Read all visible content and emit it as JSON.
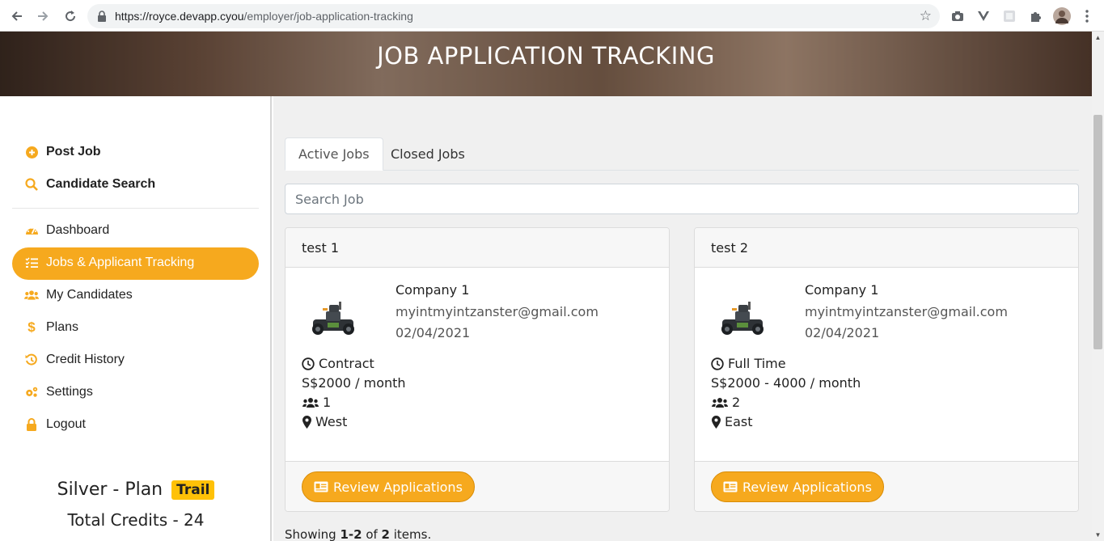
{
  "browser": {
    "url_host": "https://royce.devapp.cyou",
    "url_path": "/employer/job-application-tracking",
    "back_icon": "arrow-left-icon",
    "forward_icon": "arrow-right-icon",
    "reload_icon": "reload-icon"
  },
  "banner": {
    "title": "JOB APPLICATION TRACKING"
  },
  "sidebar": {
    "top_links": [
      {
        "label": "Post Job",
        "icon": "plus-circle-icon"
      },
      {
        "label": "Candidate Search",
        "icon": "search-icon"
      }
    ],
    "items": [
      {
        "label": "Dashboard",
        "icon": "dashboard-icon"
      },
      {
        "label": "Jobs & Applicant Tracking",
        "icon": "tasks-icon"
      },
      {
        "label": "My Candidates",
        "icon": "users-icon"
      },
      {
        "label": "Plans",
        "icon": "dollar-icon"
      },
      {
        "label": "Credit History",
        "icon": "history-icon"
      },
      {
        "label": "Settings",
        "icon": "cogs-icon"
      },
      {
        "label": "Logout",
        "icon": "lock-icon"
      }
    ],
    "active_item": "Jobs & Applicant Tracking",
    "plan_name": "Silver - Plan",
    "plan_badge": "Trail",
    "credits": "Total Credits - 24"
  },
  "tabs": [
    {
      "label": "Active Jobs",
      "active": true
    },
    {
      "label": "Closed Jobs",
      "active": false
    }
  ],
  "search": {
    "placeholder": "Search Job"
  },
  "jobs": [
    {
      "title": "test 1",
      "company": "Company 1",
      "email": "myintmyintzanster@gmail.com",
      "date": "02/04/2021",
      "type": "Contract",
      "salary": "S$2000 / month",
      "positions": "1",
      "location": "West",
      "button": "Review Applications"
    },
    {
      "title": "test 2",
      "company": "Company 1",
      "email": "myintmyintzanster@gmail.com",
      "date": "02/04/2021",
      "type": "Full Time",
      "salary": "S$2000 - 4000 / month",
      "positions": "2",
      "location": "East",
      "button": "Review Applications"
    }
  ],
  "pagination": {
    "prefix": "Showing ",
    "range": "1-2",
    "middle": " of ",
    "total": "2",
    "suffix": " items."
  },
  "colors": {
    "accent": "#f6a91e",
    "badge": "#ffc107",
    "main_bg": "#f0f0f0"
  }
}
